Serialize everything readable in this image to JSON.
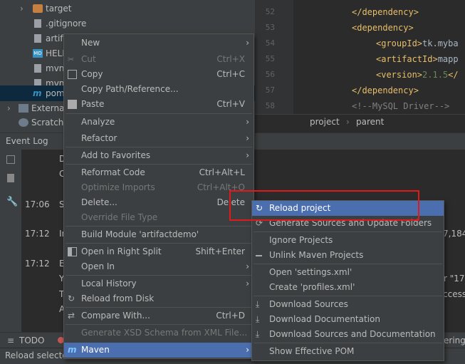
{
  "project_tree": [
    {
      "label": "target",
      "icon": "folder-icon",
      "selected": false
    },
    {
      "label": ".gitignore",
      "icon": "file-icon",
      "selected": false
    },
    {
      "label": "artifactdemo.iml",
      "icon": "file-icon",
      "selected": false
    },
    {
      "label": "HELP.md",
      "icon": "markdown-icon",
      "selected": false
    },
    {
      "label": "mvnw",
      "icon": "file-icon",
      "selected": false
    },
    {
      "label": "mvnw.cmd",
      "icon": "file-icon",
      "selected": false
    },
    {
      "label": "pom.xml",
      "icon": "maven-icon",
      "selected": true
    },
    {
      "label": "External Libraries",
      "icon": "library-icon",
      "selected": false
    },
    {
      "label": "Scratches and Consoles",
      "icon": "scratch-icon",
      "selected": false
    }
  ],
  "editor": {
    "line_numbers": [
      "52",
      "53",
      "54",
      "55",
      "56",
      "57",
      "58"
    ],
    "lines": [
      {
        "a": "</dependency>",
        "b": "",
        "c": "",
        "cls": "tag"
      },
      {
        "a": "<dependency>",
        "b": "",
        "c": "",
        "cls": "tag"
      },
      {
        "a": "<groupId>",
        "b": "tk.myba",
        "c": "",
        "cls": "tag"
      },
      {
        "a": "<artifactId>",
        "b": "mapp",
        "c": "",
        "cls": "tag"
      },
      {
        "a": "<version>",
        "b": "2.1.5",
        "c": "</",
        "cls": "tag"
      },
      {
        "a": "</dependency>",
        "b": "",
        "c": "",
        "cls": "tag"
      },
      {
        "a": "<!--MySQL Driver-->",
        "b": "",
        "c": "",
        "cls": "cmt"
      }
    ],
    "breadcrumbs": [
      "project",
      "parent"
    ]
  },
  "event_log": {
    "title": "Event Log",
    "entries": [
      {
        "time": "",
        "text": "D"
      },
      {
        "time": "",
        "text": "C"
      },
      {
        "time": "17:06",
        "text": "S"
      },
      {
        "time": "17:12",
        "text": "In"
      },
      {
        "time": "",
        "text": "7,184"
      },
      {
        "time": "17:12",
        "text": "E"
      },
      {
        "time": "",
        "text": "Y"
      },
      {
        "time": "",
        "text": "r \"17"
      },
      {
        "time": "",
        "text": "T"
      },
      {
        "time": "",
        "text": "ccess ("
      },
      {
        "time": "",
        "text": "A"
      }
    ]
  },
  "bottom_tabs": {
    "todo": "TODO",
    "right": "ering"
  },
  "status_text": "Reload selecte",
  "context_menu": [
    {
      "label": "New",
      "shortcut": "",
      "submenu": true,
      "icon": "",
      "disabled": false
    },
    {
      "label": "Cut",
      "shortcut": "Ctrl+X",
      "submenu": false,
      "icon": "scissors-icon",
      "disabled": true
    },
    {
      "label": "Copy",
      "shortcut": "Ctrl+C",
      "submenu": false,
      "icon": "copy-icon",
      "disabled": false
    },
    {
      "label": "Copy Path/Reference...",
      "shortcut": "",
      "submenu": false,
      "icon": "",
      "disabled": false
    },
    {
      "label": "Paste",
      "shortcut": "Ctrl+V",
      "submenu": false,
      "icon": "paste-icon",
      "disabled": false
    },
    {
      "label": "Analyze",
      "shortcut": "",
      "submenu": true,
      "icon": "",
      "disabled": false
    },
    {
      "label": "Refactor",
      "shortcut": "",
      "submenu": true,
      "icon": "",
      "disabled": false
    },
    {
      "label": "Add to Favorites",
      "shortcut": "",
      "submenu": true,
      "icon": "",
      "disabled": false
    },
    {
      "label": "Reformat Code",
      "shortcut": "Ctrl+Alt+L",
      "submenu": false,
      "icon": "",
      "disabled": false
    },
    {
      "label": "Optimize Imports",
      "shortcut": "Ctrl+Alt+O",
      "submenu": false,
      "icon": "",
      "disabled": true
    },
    {
      "label": "Delete...",
      "shortcut": "Delete",
      "submenu": false,
      "icon": "",
      "disabled": false
    },
    {
      "label": "Override File Type",
      "shortcut": "",
      "submenu": false,
      "icon": "",
      "disabled": true
    },
    {
      "label": "Build Module 'artifactdemo'",
      "shortcut": "",
      "submenu": false,
      "icon": "",
      "disabled": false
    },
    {
      "label": "Open in Right Split",
      "shortcut": "Shift+Enter",
      "submenu": false,
      "icon": "split-icon",
      "disabled": false
    },
    {
      "label": "Open In",
      "shortcut": "",
      "submenu": true,
      "icon": "",
      "disabled": false
    },
    {
      "label": "Local History",
      "shortcut": "",
      "submenu": true,
      "icon": "",
      "disabled": false
    },
    {
      "label": "Reload from Disk",
      "shortcut": "",
      "submenu": false,
      "icon": "reload-icon",
      "disabled": false
    },
    {
      "label": "Compare With...",
      "shortcut": "Ctrl+D",
      "submenu": false,
      "icon": "compare-icon",
      "disabled": false
    },
    {
      "label": "Generate XSD Schema from XML File...",
      "shortcut": "",
      "submenu": false,
      "icon": "",
      "disabled": true
    },
    {
      "label": "Maven",
      "shortcut": "",
      "submenu": true,
      "icon": "maven-icon",
      "disabled": false,
      "highlighted": true
    }
  ],
  "maven_submenu": [
    {
      "label": "Reload project",
      "icon": "reload-icon",
      "highlighted": true
    },
    {
      "label": "Generate Sources and Update Folders",
      "icon": "generate-icon"
    },
    {
      "label": "Ignore Projects",
      "icon": ""
    },
    {
      "label": "Unlink Maven Projects",
      "icon": "minus-icon"
    },
    {
      "label": "Open 'settings.xml'",
      "icon": ""
    },
    {
      "label": "Create 'profiles.xml'",
      "icon": ""
    },
    {
      "label": "Download Sources",
      "icon": "download-icon"
    },
    {
      "label": "Download Documentation",
      "icon": "download-icon"
    },
    {
      "label": "Download Sources and Documentation",
      "icon": "download-icon"
    },
    {
      "label": "Show Effective POM",
      "icon": ""
    }
  ],
  "colors": {
    "highlight": "#4b6eaf",
    "annotation": "#e0191b",
    "tag": "#e8bf6a",
    "version": "#6a8759"
  }
}
